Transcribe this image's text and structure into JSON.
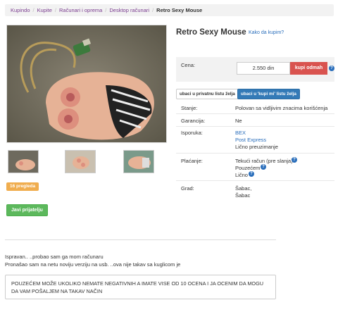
{
  "breadcrumb": {
    "items": [
      "Kupindo",
      "Kupite",
      "Računari i oprema",
      "Desktop računari"
    ],
    "current": "Retro Sexy Mouse"
  },
  "product": {
    "title": "Retro Sexy Mouse",
    "how_to_buy": "Kako da kupim?",
    "views_badge": "16 pregleda",
    "report_label": "Javi prijatelju"
  },
  "price": {
    "label": "Cena:",
    "value": "2.550 din",
    "buy_label": "kupi odmah",
    "help": "?"
  },
  "wishlist": {
    "private_label": "ubaci u privatnu listu želja",
    "buy_list_label": "ubaci u 'kupi mi' listu želja"
  },
  "details": {
    "condition_label": "Stanje:",
    "condition_value": "Polovan sa vidljivim znacima korišćenja",
    "warranty_label": "Garancija:",
    "warranty_value": "Ne",
    "shipping_label": "Isporuka:",
    "shipping_options": [
      "BEX",
      "Post Express",
      "Lično preuzimanje"
    ],
    "payment_label": "Plaćanje:",
    "payment_options": [
      "Tekući račun (pre slanja)",
      "Pouzećem",
      "Lično"
    ],
    "city_label": "Grad:",
    "city_values": [
      "Šabac,",
      "Šabac"
    ]
  },
  "description": {
    "line1": "Ispravan.. ..probao sam ga mom računaru",
    "line2": "Pronašao sam na netu noviju verziju na usb. ..ova nije takav sa kuglicom je"
  },
  "notice": "POUZEĆEM MOŽE UKOLIKO NEMATE NEGATIVNIH A IMATE VISE OD 10 OCENA I JA OCENIM DA MOGU DA VAM POŠALJEM NA TAKAV NAČIN",
  "colors": {
    "link": "#2a6ebb",
    "breadcrumb_link": "#7a3b8f",
    "buy_button": "#d9534f",
    "views_badge": "#f0ad4e",
    "report_button": "#5cb85c",
    "wishlist_button": "#337ab7"
  }
}
